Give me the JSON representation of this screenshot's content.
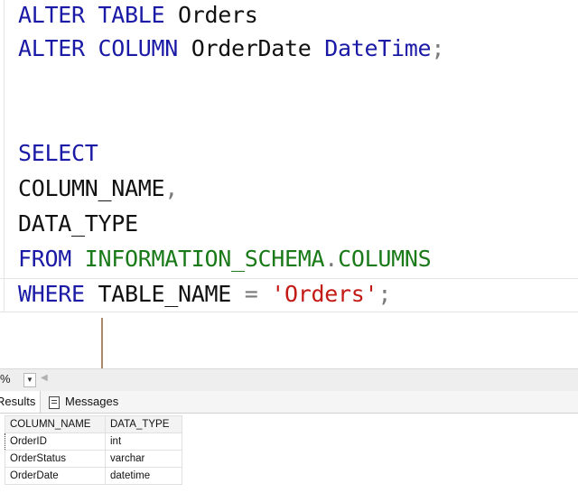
{
  "editor": {
    "lines": [
      [
        {
          "t": "ALTER TABLE ",
          "c": "kw"
        },
        {
          "t": "Orders",
          "c": "plain"
        }
      ],
      [
        {
          "t": "ALTER COLUMN ",
          "c": "kw"
        },
        {
          "t": "OrderDate ",
          "c": "plain"
        },
        {
          "t": "DateTime",
          "c": "kw"
        },
        {
          "t": ";",
          "c": "punct"
        }
      ],
      [],
      [],
      [
        {
          "t": "SELECT",
          "c": "kw"
        }
      ],
      [
        {
          "t": "COLUMN_NAME",
          "c": "plain"
        },
        {
          "t": ",",
          "c": "punct"
        }
      ],
      [
        {
          "t": "DATA_TYPE",
          "c": "plain"
        }
      ],
      [
        {
          "t": "FROM ",
          "c": "kw"
        },
        {
          "t": "INFORMATION_SCHEMA",
          "c": "sys"
        },
        {
          "t": ".",
          "c": "punct"
        },
        {
          "t": "COLUMNS",
          "c": "sys"
        }
      ],
      [
        {
          "t": "WHERE ",
          "c": "kw"
        },
        {
          "t": "TABLE_NAME ",
          "c": "plain"
        },
        {
          "t": "= ",
          "c": "punct"
        },
        {
          "t": "'Orders'",
          "c": "str"
        },
        {
          "t": ";",
          "c": "punct"
        }
      ]
    ]
  },
  "zoom": {
    "value": "%"
  },
  "tabs": {
    "results_label": "Results",
    "messages_label": "Messages"
  },
  "results": {
    "columns": [
      "COLUMN_NAME",
      "DATA_TYPE"
    ],
    "rows": [
      [
        "OrderID",
        "int"
      ],
      [
        "OrderStatus",
        "varchar"
      ],
      [
        "OrderDate",
        "datetime"
      ]
    ]
  },
  "colors": {
    "keyword": "#1a1aa6",
    "system_object": "#1a7a1a",
    "string": "#c41a16",
    "arrow": "#a88a6a"
  }
}
